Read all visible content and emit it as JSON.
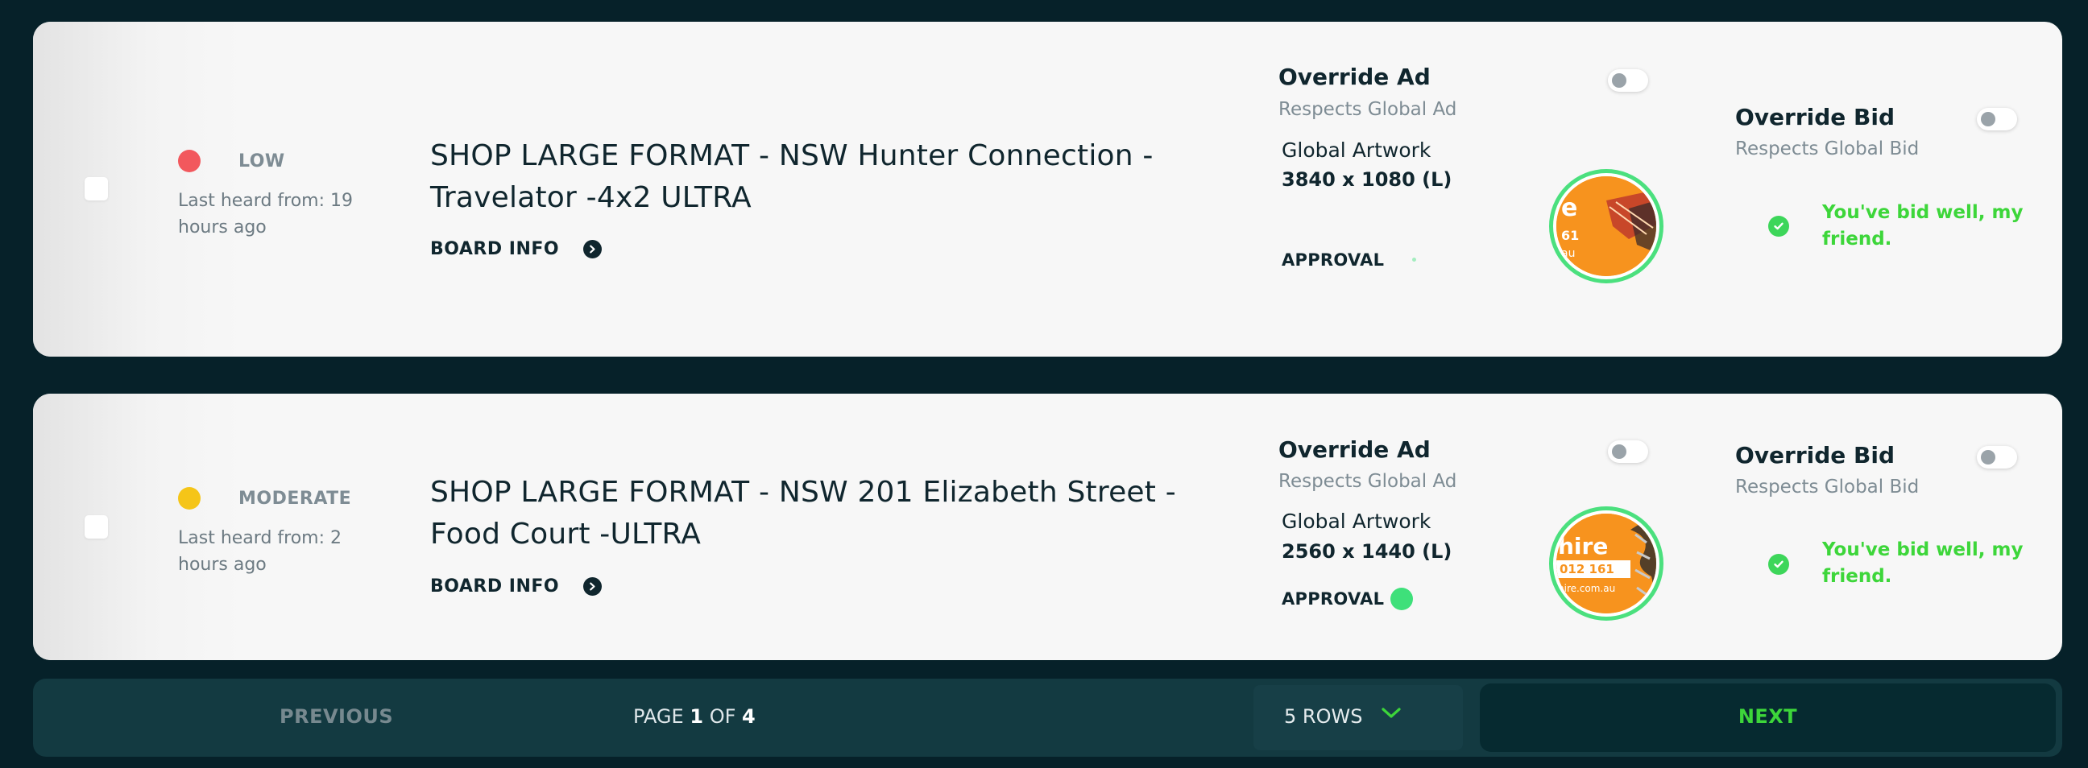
{
  "colors": {
    "low": "#f2585d",
    "moderate": "#f5c518",
    "approval": "#3ee07a",
    "success": "#3dd63a",
    "page_background": "#062129"
  },
  "boards": [
    {
      "status": "LOW",
      "status_color": "#f2585d",
      "last_heard": "Last heard from: 19 hours ago",
      "title": "SHOP LARGE FORMAT - NSW Hunter Connection - Travelator -4x2 ULTRA",
      "board_info_label": "BOARD INFO",
      "override_ad_label": "Override Ad",
      "override_ad_sub": "Respects Global Ad",
      "override_ad_on": false,
      "global_artwork_label": "Global Artwork",
      "artwork_size": "3840 x 1080 (L)",
      "approval_label": "APPROVAL",
      "artwork_text": [
        "e",
        "61",
        "au"
      ],
      "override_bid_label": "Override Bid",
      "override_bid_sub": "Respects Global Bid",
      "override_bid_on": false,
      "bid_message": "You've bid well, my friend."
    },
    {
      "status": "MODERATE",
      "status_color": "#f5c518",
      "last_heard": "Last heard from: 2 hours ago",
      "title": "SHOP LARGE FORMAT - NSW 201 Elizabeth Street - Food Court -ULTRA",
      "board_info_label": "BOARD INFO",
      "override_ad_label": "Override Ad",
      "override_ad_sub": "Respects Global Ad",
      "override_ad_on": false,
      "global_artwork_label": "Global Artwork",
      "artwork_size": "2560 x 1440 (L)",
      "approval_label": "APPROVAL",
      "artwork_text": [
        "hire",
        "012 161",
        "hire.com.au"
      ],
      "override_bid_label": "Override Bid",
      "override_bid_sub": "Respects Global Bid",
      "override_bid_on": false,
      "bid_message": "You've bid well, my friend."
    }
  ],
  "pagination": {
    "previous_label": "PREVIOUS",
    "page_word": "PAGE",
    "current_page": "1",
    "of_word": "OF",
    "total_pages": "4",
    "rows_label": "5 ROWS",
    "next_label": "NEXT"
  }
}
